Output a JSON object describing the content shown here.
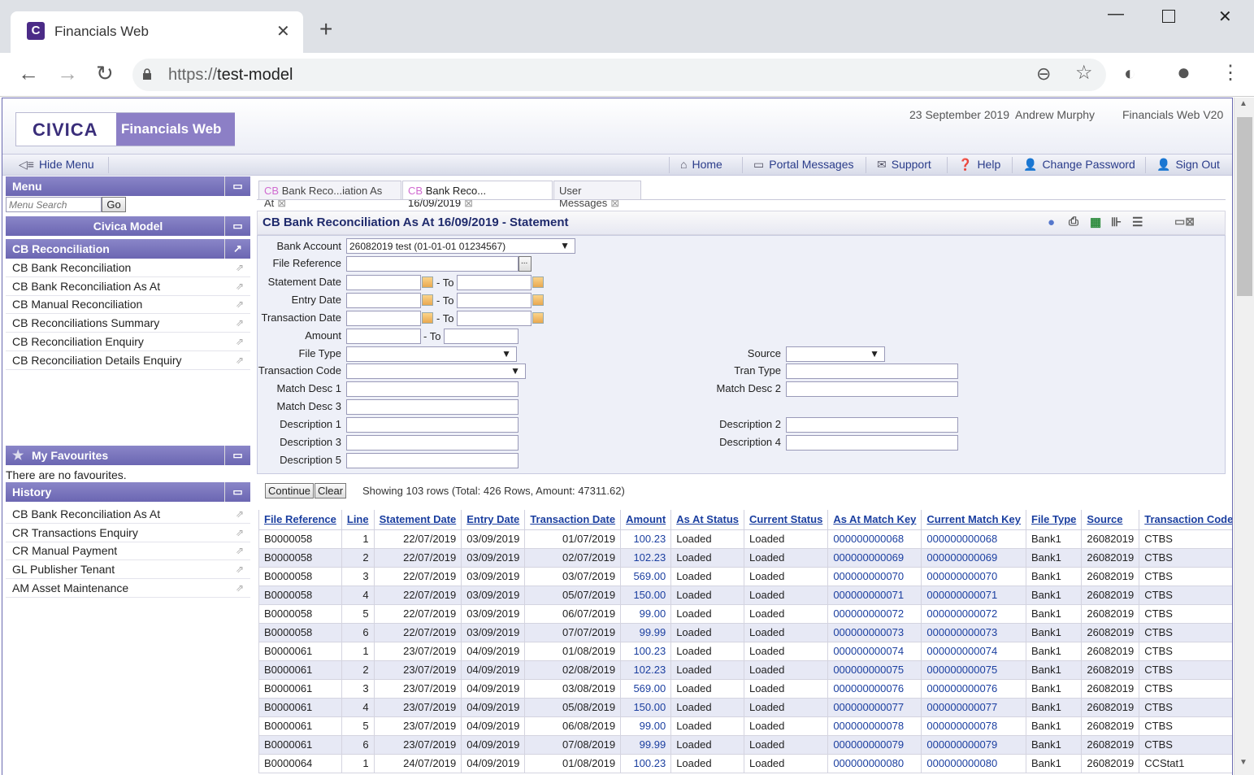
{
  "browser": {
    "tab_title": "Financials Web",
    "url_scheme": "https://",
    "url_host": "test-model"
  },
  "header": {
    "logo_civica": "CIVICA",
    "logo_product": "Financials Web",
    "date": "23 September 2019",
    "user": "Andrew Murphy",
    "version": "Financials Web V20"
  },
  "menubar": {
    "hide_menu": "Hide Menu",
    "home": "Home",
    "portal_messages": "Portal Messages",
    "support": "Support",
    "help": "Help",
    "change_password": "Change Password",
    "sign_out": "Sign Out"
  },
  "sidebar": {
    "menu_title": "Menu",
    "search_placeholder": "Menu Search",
    "go": "Go",
    "model": "Civica Model",
    "section": "CB Reconciliation",
    "items": [
      "CB Bank Reconciliation",
      "CB Bank Reconciliation As At",
      "CB Manual Reconciliation",
      "CB Reconciliations Summary",
      "CB Reconciliation Enquiry",
      "CB Reconciliation Details Enquiry"
    ],
    "favourites_title": "My Favourites",
    "favourites_empty": "There are no favourites.",
    "history_title": "History",
    "history": [
      "CB Bank Reconciliation As At",
      "CR Transactions Enquiry",
      "CR Manual Payment",
      "GL Publisher Tenant",
      "AM Asset Maintenance"
    ]
  },
  "content_tabs": [
    {
      "prefix": "CB",
      "label": "Bank Reco...iation As At"
    },
    {
      "prefix": "CB",
      "label": "Bank Reco... 16/09/2019"
    },
    {
      "prefix": "",
      "label": "User Messages"
    }
  ],
  "page_title": "CB Bank Reconciliation As At 16/09/2019 - Statement",
  "form": {
    "bank_account_label": "Bank Account",
    "bank_account_value": "26082019 test (01-01-01 01234567)",
    "file_reference": "File Reference",
    "statement_date": "Statement Date",
    "entry_date": "Entry Date",
    "transaction_date": "Transaction Date",
    "amount": "Amount",
    "to": "- To",
    "file_type": "File Type",
    "transaction_code": "Transaction Code",
    "match_desc_1": "Match Desc 1",
    "match_desc_3": "Match Desc 3",
    "description_1": "Description 1",
    "description_3": "Description 3",
    "description_5": "Description 5",
    "source": "Source",
    "tran_type": "Tran Type",
    "match_desc_2": "Match Desc 2",
    "description_2": "Description 2",
    "description_4": "Description 4",
    "continue": "Continue",
    "clear": "Clear",
    "showing": "Showing 103 rows (Total: 426 Rows, Amount: 47311.62)"
  },
  "table": {
    "columns": [
      "File Reference",
      "Line",
      "Statement Date",
      "Entry Date",
      "Transaction Date",
      "Amount",
      "As At Status",
      "Current Status",
      "As At Match Key",
      "Current Match Key",
      "File Type",
      "Source",
      "Transaction Code"
    ],
    "rows": [
      [
        "B0000058",
        "1",
        "22/07/2019",
        "03/09/2019",
        "01/07/2019",
        "100.23",
        "Loaded",
        "Loaded",
        "000000000068",
        "000000000068",
        "Bank1",
        "26082019",
        "CTBS"
      ],
      [
        "B0000058",
        "2",
        "22/07/2019",
        "03/09/2019",
        "02/07/2019",
        "102.23",
        "Loaded",
        "Loaded",
        "000000000069",
        "000000000069",
        "Bank1",
        "26082019",
        "CTBS"
      ],
      [
        "B0000058",
        "3",
        "22/07/2019",
        "03/09/2019",
        "03/07/2019",
        "569.00",
        "Loaded",
        "Loaded",
        "000000000070",
        "000000000070",
        "Bank1",
        "26082019",
        "CTBS"
      ],
      [
        "B0000058",
        "4",
        "22/07/2019",
        "03/09/2019",
        "05/07/2019",
        "150.00",
        "Loaded",
        "Loaded",
        "000000000071",
        "000000000071",
        "Bank1",
        "26082019",
        "CTBS"
      ],
      [
        "B0000058",
        "5",
        "22/07/2019",
        "03/09/2019",
        "06/07/2019",
        "99.00",
        "Loaded",
        "Loaded",
        "000000000072",
        "000000000072",
        "Bank1",
        "26082019",
        "CTBS"
      ],
      [
        "B0000058",
        "6",
        "22/07/2019",
        "03/09/2019",
        "07/07/2019",
        "99.99",
        "Loaded",
        "Loaded",
        "000000000073",
        "000000000073",
        "Bank1",
        "26082019",
        "CTBS"
      ],
      [
        "B0000061",
        "1",
        "23/07/2019",
        "04/09/2019",
        "01/08/2019",
        "100.23",
        "Loaded",
        "Loaded",
        "000000000074",
        "000000000074",
        "Bank1",
        "26082019",
        "CTBS"
      ],
      [
        "B0000061",
        "2",
        "23/07/2019",
        "04/09/2019",
        "02/08/2019",
        "102.23",
        "Loaded",
        "Loaded",
        "000000000075",
        "000000000075",
        "Bank1",
        "26082019",
        "CTBS"
      ],
      [
        "B0000061",
        "3",
        "23/07/2019",
        "04/09/2019",
        "03/08/2019",
        "569.00",
        "Loaded",
        "Loaded",
        "000000000076",
        "000000000076",
        "Bank1",
        "26082019",
        "CTBS"
      ],
      [
        "B0000061",
        "4",
        "23/07/2019",
        "04/09/2019",
        "05/08/2019",
        "150.00",
        "Loaded",
        "Loaded",
        "000000000077",
        "000000000077",
        "Bank1",
        "26082019",
        "CTBS"
      ],
      [
        "B0000061",
        "5",
        "23/07/2019",
        "04/09/2019",
        "06/08/2019",
        "99.00",
        "Loaded",
        "Loaded",
        "000000000078",
        "000000000078",
        "Bank1",
        "26082019",
        "CTBS"
      ],
      [
        "B0000061",
        "6",
        "23/07/2019",
        "04/09/2019",
        "07/08/2019",
        "99.99",
        "Loaded",
        "Loaded",
        "000000000079",
        "000000000079",
        "Bank1",
        "26082019",
        "CTBS"
      ],
      [
        "B0000064",
        "1",
        "24/07/2019",
        "04/09/2019",
        "01/08/2019",
        "100.23",
        "Loaded",
        "Loaded",
        "000000000080",
        "000000000080",
        "Bank1",
        "26082019",
        "CCStat1"
      ]
    ]
  },
  "colors": {
    "accent": "#6b66b2",
    "link": "#1b3fa0",
    "alt_row": "#e7e9f5"
  }
}
